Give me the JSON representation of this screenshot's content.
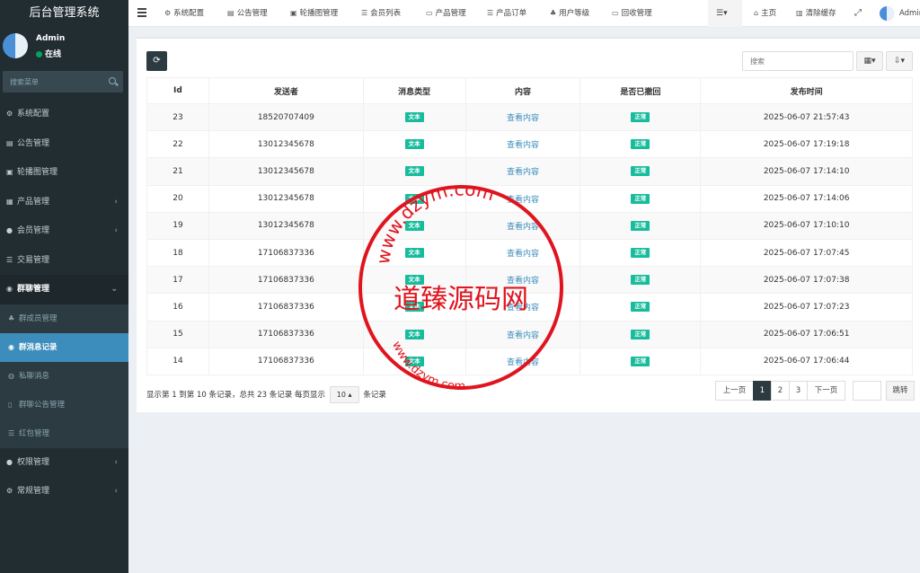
{
  "app": {
    "title": "后台管理系统"
  },
  "user": {
    "name": "Admin",
    "status": "在线"
  },
  "sidebar": {
    "search_placeholder": "搜索菜单",
    "items": [
      {
        "label": "系统配置",
        "icon": "gear-icon",
        "glyph": "⚙"
      },
      {
        "label": "公告管理",
        "icon": "file-icon",
        "glyph": "▤"
      },
      {
        "label": "轮播图管理",
        "icon": "image-icon",
        "glyph": "▣"
      },
      {
        "label": "产品管理",
        "icon": "grid-icon",
        "glyph": "▦"
      },
      {
        "label": "会员管理",
        "icon": "user-icon",
        "glyph": "●"
      },
      {
        "label": "交易管理",
        "icon": "list-icon",
        "glyph": "☰"
      },
      {
        "label": "群聊管理",
        "icon": "comments-icon",
        "glyph": "◉"
      }
    ],
    "subitems": [
      {
        "label": "群成员管理",
        "icon": "sitemap-icon",
        "glyph": "♣"
      },
      {
        "label": "群消息记录",
        "icon": "comments-icon",
        "glyph": "◉"
      },
      {
        "label": "私聊消息",
        "icon": "comment-icon",
        "glyph": "◍"
      },
      {
        "label": "群聊公告管理",
        "icon": "bookmark-icon",
        "glyph": "▯"
      },
      {
        "label": "红包管理",
        "icon": "list-icon",
        "glyph": "☰"
      }
    ],
    "bottom_items": [
      {
        "label": "权限管理",
        "icon": "users-icon",
        "glyph": "●"
      },
      {
        "label": "常规管理",
        "icon": "cogs-icon",
        "glyph": "⚙"
      }
    ]
  },
  "topnav": {
    "items": [
      {
        "label": "系统配置",
        "icon": "gear-icon",
        "glyph": "⚙"
      },
      {
        "label": "公告管理",
        "icon": "file-icon",
        "glyph": "▤"
      },
      {
        "label": "轮播图管理",
        "icon": "image-icon",
        "glyph": "▣"
      },
      {
        "label": "会员列表",
        "icon": "list-icon",
        "glyph": "☰"
      },
      {
        "label": "产品管理",
        "icon": "card-icon",
        "glyph": "▭"
      },
      {
        "label": "产品订单",
        "icon": "list-icon",
        "glyph": "☰"
      },
      {
        "label": "用户等级",
        "icon": "sitemap-icon",
        "glyph": "♣"
      },
      {
        "label": "回收管理",
        "icon": "card-icon",
        "glyph": "▭"
      }
    ],
    "home": "主页",
    "clear_cache": "清除缓存",
    "admin": "Admin"
  },
  "toolbar": {
    "search_placeholder": "搜索"
  },
  "table": {
    "columns": [
      "Id",
      "发送者",
      "消息类型",
      "内容",
      "是否已撤回",
      "发布时间"
    ],
    "rows": [
      {
        "id": "23",
        "sender": "18520707409",
        "type": "文本",
        "content": "查看内容",
        "revoked": "正常",
        "time": "2025-06-07 21:57:43"
      },
      {
        "id": "22",
        "sender": "13012345678",
        "type": "文本",
        "content": "查看内容",
        "revoked": "正常",
        "time": "2025-06-07 17:19:18"
      },
      {
        "id": "21",
        "sender": "13012345678",
        "type": "文本",
        "content": "查看内容",
        "revoked": "正常",
        "time": "2025-06-07 17:14:10"
      },
      {
        "id": "20",
        "sender": "13012345678",
        "type": "文本",
        "content": "查看内容",
        "revoked": "正常",
        "time": "2025-06-07 17:14:06"
      },
      {
        "id": "19",
        "sender": "13012345678",
        "type": "文本",
        "content": "查看内容",
        "revoked": "正常",
        "time": "2025-06-07 17:10:10"
      },
      {
        "id": "18",
        "sender": "17106837336",
        "type": "文本",
        "content": "查看内容",
        "revoked": "正常",
        "time": "2025-06-07 17:07:45"
      },
      {
        "id": "17",
        "sender": "17106837336",
        "type": "文本",
        "content": "查看内容",
        "revoked": "正常",
        "time": "2025-06-07 17:07:38"
      },
      {
        "id": "16",
        "sender": "17106837336",
        "type": "文本",
        "content": "查看内容",
        "revoked": "正常",
        "time": "2025-06-07 17:07:23"
      },
      {
        "id": "15",
        "sender": "17106837336",
        "type": "文本",
        "content": "查看内容",
        "revoked": "正常",
        "time": "2025-06-07 17:06:51"
      },
      {
        "id": "14",
        "sender": "17106837336",
        "type": "文本",
        "content": "查看内容",
        "revoked": "正常",
        "time": "2025-06-07 17:06:44"
      }
    ]
  },
  "pager": {
    "info_prefix": "显示第 1 到第 10 条记录，总共 23 条记录 每页显示",
    "page_size": "10",
    "info_suffix": "条记录",
    "prev": "上一页",
    "pages": [
      "1",
      "2",
      "3"
    ],
    "current": "1",
    "next": "下一页",
    "jump": "跳转"
  },
  "watermark": {
    "center_text": "道臻源码网",
    "ring_text": "www.dzym.com"
  },
  "colors": {
    "sidebar_bg": "#222d32",
    "active": "#3c8dbc",
    "badge": "#18bc9c",
    "stamp": "#e0141e"
  }
}
